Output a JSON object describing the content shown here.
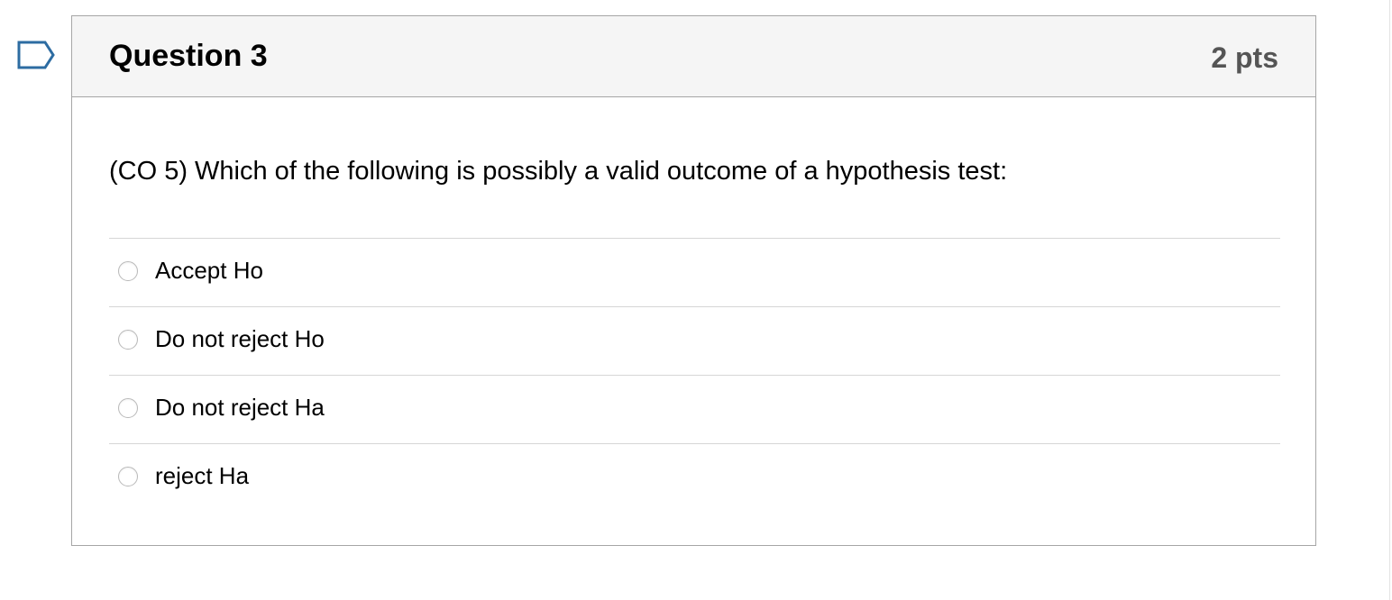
{
  "question": {
    "flag_icon": "bookmark-flag-icon",
    "title": "Question 3",
    "points": "2 pts",
    "text": "(CO 5) Which of the following is possibly a valid outcome of a hypothesis test:",
    "answers": [
      {
        "label": "Accept Ho",
        "selected": false
      },
      {
        "label": "Do not reject Ho",
        "selected": false
      },
      {
        "label": "Do not reject Ha",
        "selected": false
      },
      {
        "label": "reject Ha",
        "selected": false
      }
    ]
  },
  "colors": {
    "header_background": "#f5f5f5",
    "border": "#a6a6a6",
    "flag_outline": "#2d6ca2",
    "points_text": "#555555",
    "divider": "#d6d6d6"
  }
}
